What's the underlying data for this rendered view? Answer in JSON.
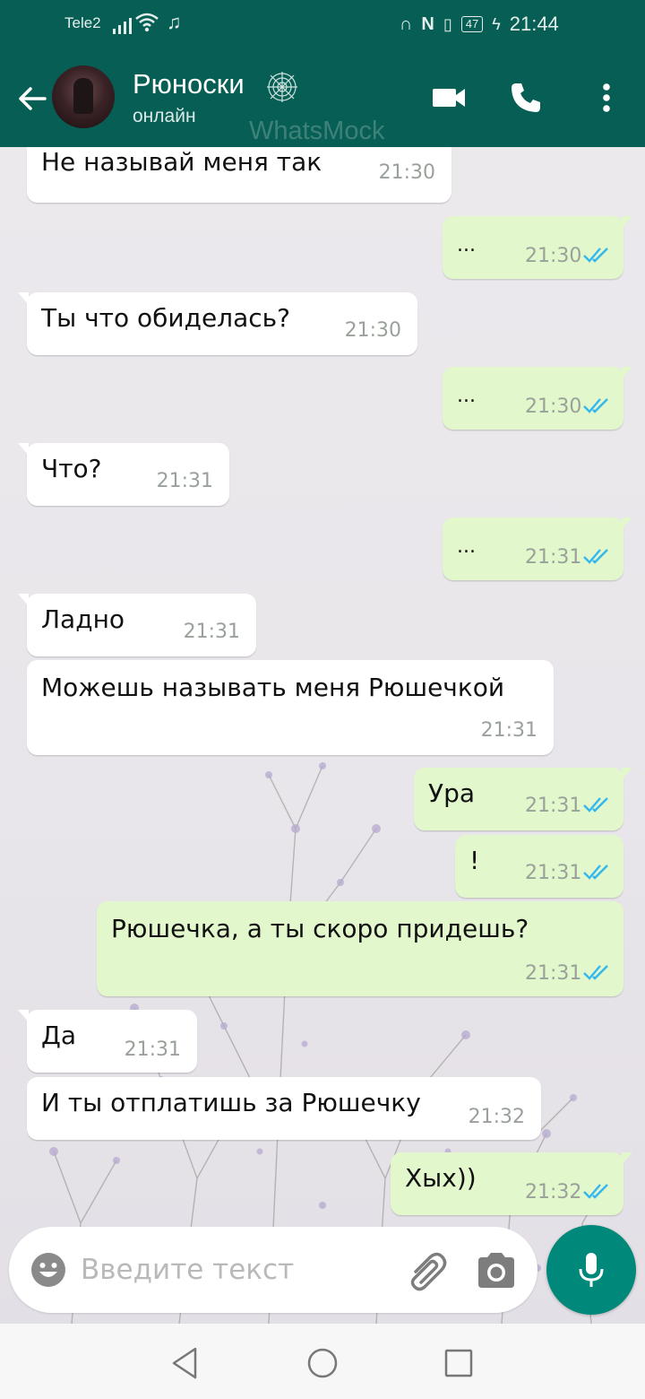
{
  "status_bar": {
    "carrier": "Tele2",
    "battery": "47",
    "time": "21:44"
  },
  "header": {
    "contact_name": "Рюноски",
    "status": "онлайн",
    "watermark": "WhatsMock"
  },
  "messages": [
    {
      "dir": "in",
      "text": "Не называй меня так",
      "time": "21:30"
    },
    {
      "dir": "out",
      "text": "...",
      "time": "21:30",
      "read": true
    },
    {
      "dir": "in",
      "text": "Ты что обиделась?",
      "time": "21:30"
    },
    {
      "dir": "out",
      "text": "...",
      "time": "21:30",
      "read": true
    },
    {
      "dir": "in",
      "text": "Что?",
      "time": "21:31"
    },
    {
      "dir": "out",
      "text": "...",
      "time": "21:31",
      "read": true
    },
    {
      "dir": "in",
      "text": "Ладно",
      "time": "21:31"
    },
    {
      "dir": "in",
      "text": "Можешь называть меня Рюшечкой",
      "time": "21:31"
    },
    {
      "dir": "out",
      "text": "Ура",
      "time": "21:31",
      "read": true
    },
    {
      "dir": "out",
      "text": "!",
      "time": "21:31",
      "read": true
    },
    {
      "dir": "out",
      "text": "Рюшечка, а ты скоро придешь?",
      "time": "21:31",
      "read": true
    },
    {
      "dir": "in",
      "text": "Да",
      "time": "21:31"
    },
    {
      "dir": "in",
      "text": "И ты отплатишь за Рюшечку",
      "time": "21:32"
    },
    {
      "dir": "out",
      "text": "Хых))",
      "time": "21:32",
      "read": true
    }
  ],
  "input": {
    "placeholder": "Введите текст"
  },
  "colors": {
    "header": "#075e54",
    "outgoing_bubble": "#e2f7cb",
    "incoming_bubble": "#ffffff",
    "mic_button": "#00897b",
    "read_ticks": "#34b7f1"
  }
}
